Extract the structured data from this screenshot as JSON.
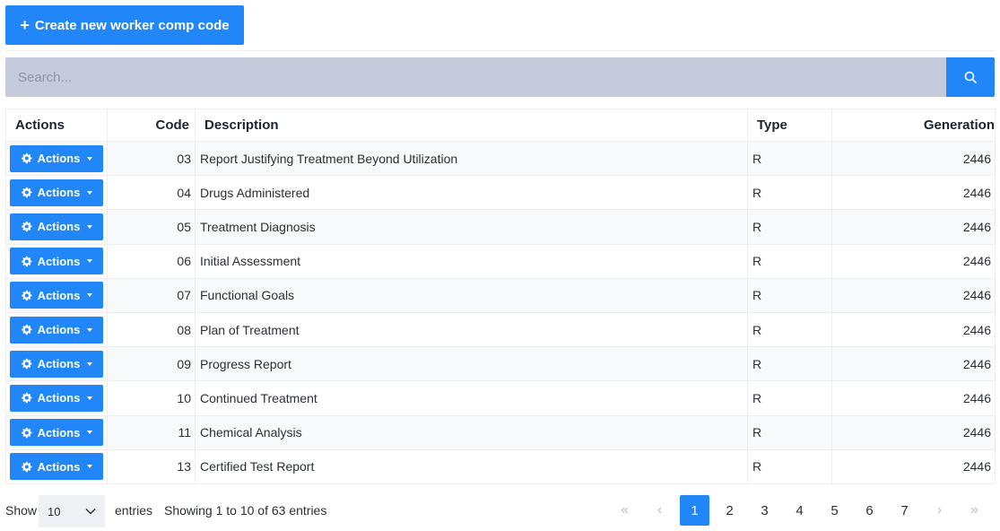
{
  "toolbar": {
    "create_label": "Create new worker comp code",
    "create_icon": "plus-icon"
  },
  "search": {
    "placeholder": "Search...",
    "icon": "search-icon"
  },
  "table": {
    "headers": {
      "actions": "Actions",
      "code": "Code",
      "description": "Description",
      "type": "Type",
      "generation": "Generation"
    },
    "action_label": "Actions",
    "rows": [
      {
        "code": "03",
        "description": "Report Justifying Treatment Beyond Utilization",
        "type": "R",
        "generation": "2446"
      },
      {
        "code": "04",
        "description": "Drugs Administered",
        "type": "R",
        "generation": "2446"
      },
      {
        "code": "05",
        "description": "Treatment Diagnosis",
        "type": "R",
        "generation": "2446"
      },
      {
        "code": "06",
        "description": "Initial Assessment",
        "type": "R",
        "generation": "2446"
      },
      {
        "code": "07",
        "description": "Functional Goals",
        "type": "R",
        "generation": "2446"
      },
      {
        "code": "08",
        "description": "Plan of Treatment",
        "type": "R",
        "generation": "2446"
      },
      {
        "code": "09",
        "description": "Progress Report",
        "type": "R",
        "generation": "2446"
      },
      {
        "code": "10",
        "description": "Continued Treatment",
        "type": "R",
        "generation": "2446"
      },
      {
        "code": "11",
        "description": "Chemical Analysis",
        "type": "R",
        "generation": "2446"
      },
      {
        "code": "13",
        "description": "Certified Test Report",
        "type": "R",
        "generation": "2446"
      }
    ]
  },
  "footer": {
    "show_label": "Show",
    "page_length": "10",
    "entries_label": "entries",
    "info": "Showing 1 to 10 of 63 entries",
    "pages": [
      "1",
      "2",
      "3",
      "4",
      "5",
      "6",
      "7"
    ],
    "active_page": "1",
    "first": "«",
    "prev": "‹",
    "next": "›",
    "last": "»"
  },
  "colors": {
    "accent": "#2186f7",
    "search_bg": "#c5cbda"
  }
}
